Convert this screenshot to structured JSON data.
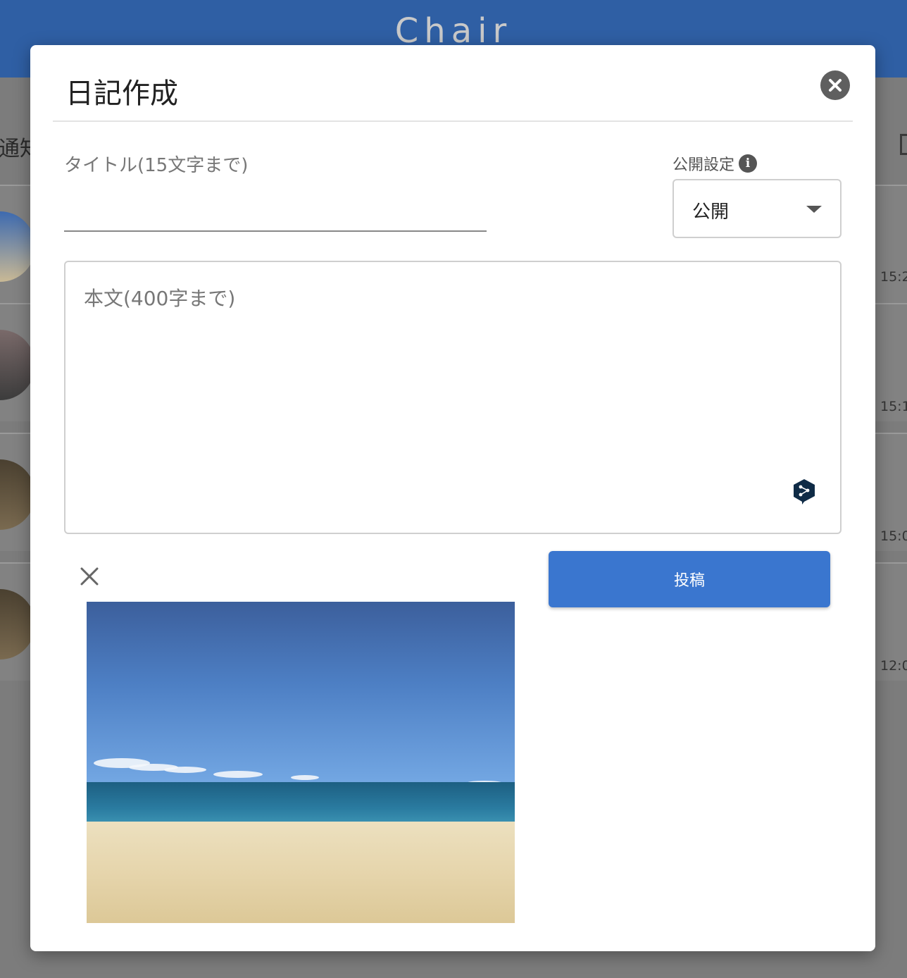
{
  "app": {
    "title": "Chair"
  },
  "background": {
    "notify_label": "通知",
    "rows": [
      {
        "time": "15:2"
      },
      {
        "time": "15:1"
      },
      {
        "time": "15:0"
      },
      {
        "time": "12:0"
      }
    ]
  },
  "modal": {
    "title": "日記作成",
    "title_field": {
      "label": "タイトル(15文字まで)",
      "value": ""
    },
    "visibility": {
      "label": "公開設定",
      "value": "公開"
    },
    "body_field": {
      "placeholder": "本文(400字まで)"
    },
    "post_button": "投稿"
  },
  "colors": {
    "header": "#2f5fa4",
    "primary": "#3a76cf"
  }
}
